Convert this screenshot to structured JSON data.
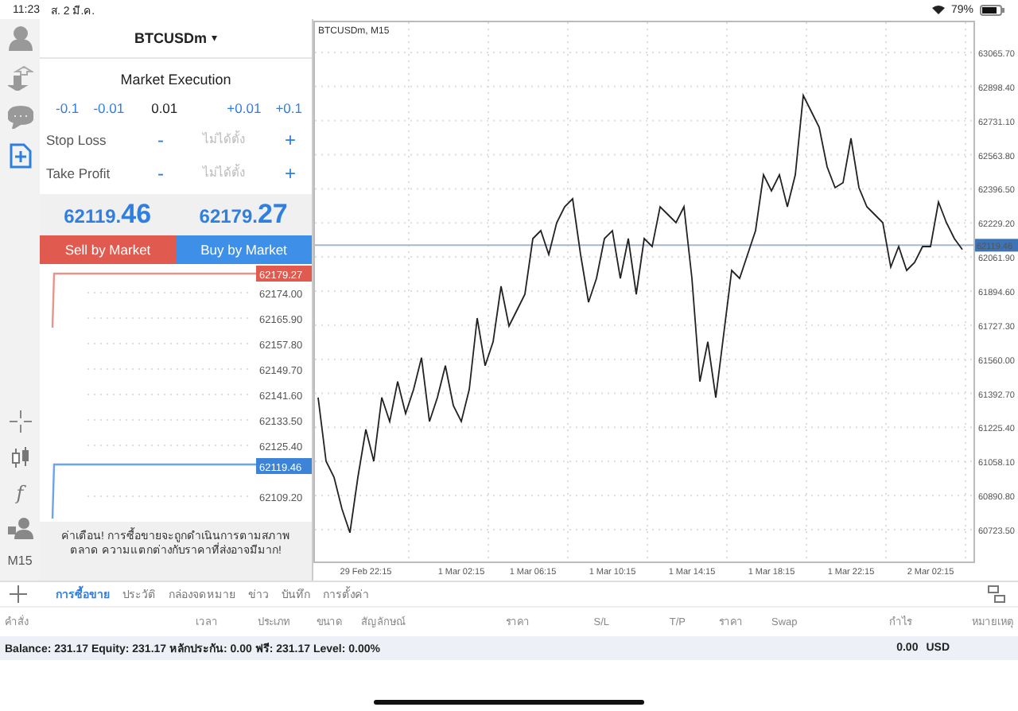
{
  "status_bar": {
    "time": "11:23",
    "date": "ส. 2 มี.ค.",
    "battery": "79%"
  },
  "side_rail": {
    "items": [
      {
        "kind": "account",
        "selected": false
      },
      {
        "kind": "trade",
        "selected": false
      },
      {
        "kind": "chat",
        "selected": false
      },
      {
        "kind": "new-order",
        "selected": true
      }
    ],
    "tools": [
      {
        "kind": "crosshair"
      },
      {
        "kind": "candles"
      },
      {
        "kind": "indicator",
        "label": "f"
      },
      {
        "kind": "objects"
      }
    ],
    "timeframe": "M15"
  },
  "order": {
    "symbol": "BTCUSDm",
    "caret": "▾",
    "execution": "Market Execution",
    "volume": [
      {
        "label": "-0.1",
        "kind": "step"
      },
      {
        "label": "-0.01",
        "kind": "step"
      },
      {
        "label": "0.01",
        "kind": "value"
      },
      {
        "label": "+0.01",
        "kind": "step"
      },
      {
        "label": "+0.1",
        "kind": "step"
      }
    ],
    "stops": [
      {
        "label": "Stop Loss",
        "minus": "-",
        "placeholder": "ไม่ได้ตั้ง",
        "plus": "+"
      },
      {
        "label": "Take Profit",
        "minus": "-",
        "placeholder": "ไม่ได้ตั้ง",
        "plus": "+"
      }
    ],
    "bid": "62119.46",
    "ask": "62179.27",
    "sell_button": "Sell by Market",
    "buy_button": "Buy by Market",
    "tick_labels": [
      {
        "text": "62179.27",
        "kind": "ask"
      },
      {
        "text": "62174.00",
        "kind": "plain"
      },
      {
        "text": "62165.90",
        "kind": "plain"
      },
      {
        "text": "62157.80",
        "kind": "plain"
      },
      {
        "text": "62149.70",
        "kind": "plain"
      },
      {
        "text": "62141.60",
        "kind": "plain"
      },
      {
        "text": "62133.50",
        "kind": "plain"
      },
      {
        "text": "62125.40",
        "kind": "plain"
      },
      {
        "text": "62119.46",
        "kind": "bid"
      },
      {
        "text": "62109.20",
        "kind": "plain"
      }
    ],
    "warning": "ค่าเตือน! การซื้อขายจะถูกดำเนินการตามสภาพตลาด ความแตกต่างกับราคาที่ส่งอาจมีมาก!"
  },
  "chart": {
    "title": "BTCUSDm, M15",
    "chart_data": {
      "type": "line",
      "ylim": [
        60567,
        63214
      ],
      "grid": true,
      "ref_lines": [
        {
          "axis": "y",
          "value": 62119.46,
          "label": "62119.46",
          "color": "#a8b8cc"
        }
      ],
      "categories": [
        null,
        null,
        null,
        null,
        null,
        null,
        "29 Feb 22:15",
        null,
        null,
        null,
        null,
        null,
        null,
        null,
        null,
        null,
        null,
        null,
        "1 Mar 02:15",
        null,
        null,
        null,
        null,
        null,
        null,
        null,
        null,
        "1 Mar 06:15",
        null,
        null,
        null,
        null,
        null,
        null,
        null,
        null,
        null,
        "1 Mar 10:15",
        null,
        null,
        null,
        null,
        null,
        null,
        null,
        null,
        null,
        "1 Mar 14:15",
        null,
        null,
        null,
        null,
        null,
        null,
        null,
        null,
        null,
        "1 Mar 18:15",
        null,
        null,
        null,
        null,
        null,
        null,
        null,
        null,
        null,
        "1 Mar 22:15",
        null,
        null,
        null,
        null,
        null,
        null,
        null,
        null,
        null,
        "2 Mar 02:15",
        null,
        null,
        null,
        null
      ],
      "yticks": [
        {
          "value": 63065.7,
          "label": "63065.70"
        },
        {
          "value": 62898.4,
          "label": "62898.40"
        },
        {
          "value": 62731.1,
          "label": "62731.10"
        },
        {
          "value": 62563.8,
          "label": "62563.80"
        },
        {
          "value": 62396.5,
          "label": "62396.50"
        },
        {
          "value": 62229.2,
          "label": "62229.20"
        },
        {
          "value": 62061.9,
          "label": "62061.90"
        },
        {
          "value": 61894.6,
          "label": "61894.60"
        },
        {
          "value": 61727.3,
          "label": "61727.30"
        },
        {
          "value": 61560,
          "label": "61560.00"
        },
        {
          "value": 61392.7,
          "label": "61392.70"
        },
        {
          "value": 61225.4,
          "label": "61225.40"
        },
        {
          "value": 61058.1,
          "label": "61058.10"
        },
        {
          "value": 60890.8,
          "label": "60890.80"
        },
        {
          "value": 60723.5,
          "label": "60723.50"
        }
      ],
      "series": [
        {
          "color": "#222222",
          "values": [
            61372,
            61059,
            60981,
            60825,
            60708,
            60981,
            61215,
            61059,
            61372,
            61254,
            61450,
            61293,
            61411,
            61567,
            61254,
            61372,
            61528,
            61332,
            61254,
            61411,
            61762,
            61528,
            61645,
            61918,
            61723,
            61801,
            61879,
            62152,
            62191,
            62074,
            62230,
            62308,
            62347,
            62074,
            61840,
            61957,
            62152,
            62191,
            61957,
            62152,
            61879,
            62152,
            62113,
            62308,
            62269,
            62230,
            62308,
            61957,
            61450,
            61645,
            61372,
            61684,
            61996,
            61957,
            62074,
            62191,
            62465,
            62386,
            62465,
            62308,
            62465,
            62855,
            62777,
            62699,
            62504,
            62402,
            62426,
            62644,
            62402,
            62308,
            62269,
            62230,
            62012,
            62113,
            61996,
            62035,
            62113,
            62113,
            62332,
            62230,
            62152,
            62098
          ]
        }
      ]
    }
  },
  "bottom_tabs": [
    {
      "label": "การซื้อขาย",
      "selected": true
    },
    {
      "label": "ประวัติ",
      "selected": false
    },
    {
      "label": "กล่องจดหมาย",
      "selected": false
    },
    {
      "label": "ข่าว",
      "selected": false
    },
    {
      "label": "บันทึก",
      "selected": false
    },
    {
      "label": "การตั้งค่า",
      "selected": false
    }
  ],
  "table": {
    "columns": [
      "คำสั่ง",
      "เวลา",
      "ประเภท",
      "ขนาด",
      "สัญลักษณ์",
      "ราคา",
      "S/L",
      "T/P",
      "ราคา",
      "Swap",
      "กำไร",
      "หมายเหตุ"
    ],
    "summary": "Balance: 231.17 Equity: 231.17 หลักประกัน: 0.00 ฟรี: 231.17 Level: 0.00%",
    "profit": "0.00",
    "currency": "USD"
  }
}
